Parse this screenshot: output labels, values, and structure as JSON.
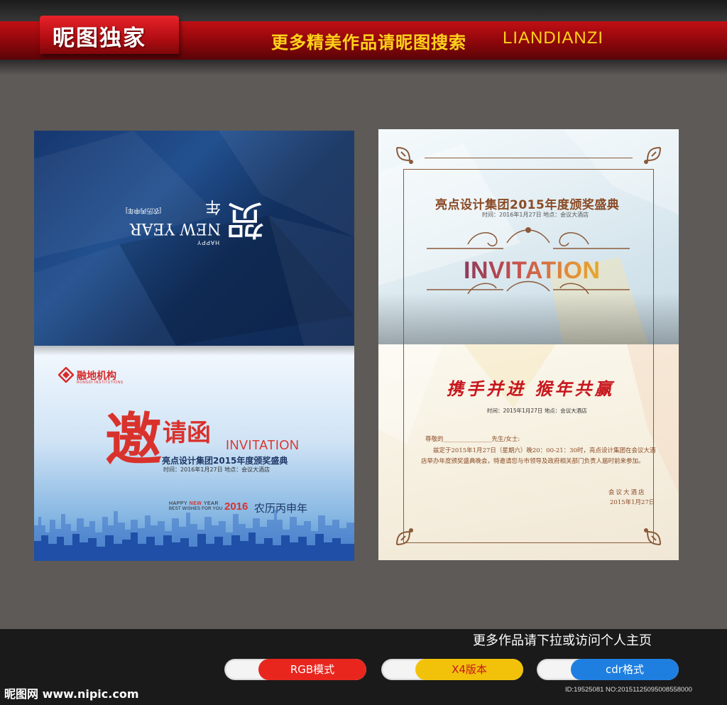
{
  "header": {
    "brand": "昵图独家",
    "slogan": "更多精美作品请昵图搜索",
    "slogan_en": "LIANDIANZI"
  },
  "left_card": {
    "cover": {
      "big": "贺",
      "happy": "HAPPY",
      "ny": "NEW YEAR 年",
      "sub": "[农历丙申年]"
    },
    "logo_cn": "融地机构",
    "logo_en": "RONGDI INSTITUTIONS",
    "inv_big": "邀",
    "inv_2": "请函",
    "inv_en": "INVITATION",
    "title": "亮点设计集团2015年度颁奖盛典",
    "time": "时间：2016年1月27日    地点：会议大酒店",
    "happy_ny_pre": "HAPPY ",
    "happy_ny_b": "NEW ",
    "happy_ny_post": "YEAR",
    "best_wishes": "BEST WISHES FOR YOU",
    "year": "2016",
    "lunar": "农历丙申年"
  },
  "right_card": {
    "title": "亮点设计集团2015年度颁奖盛典",
    "time": "时间：2016年1月27日    地点：会议大酒店",
    "invitation": "INVITATION",
    "slogan": "携手并进  猴年共赢",
    "time2": "时间：2015年1月27日    地点：会议大酒店",
    "dear": "尊敬的________________先生/女士:",
    "body": "兹定于2015年1月27日（星期六）晚20：00-21：30时，亮点设计集团在会议大酒店举办年度颁奖盛典晚会，特邀请您与市领导及政府相关部门负责人届时前来参加。",
    "sign1": "会议大酒店",
    "sign2": "2015年1月27日"
  },
  "footer": {
    "more": "更多作品请下拉或访问个人主页",
    "pills": [
      {
        "label": "RGB模式",
        "color": "#e8261e",
        "text_color": "#ffffff"
      },
      {
        "label": "X4版本",
        "color": "#f2c20a",
        "text_color": "#c8161d"
      },
      {
        "label": "cdr格式",
        "color": "#1e7fe0",
        "text_color": "#ffffff"
      }
    ],
    "site": "昵图网 www.nipic.com",
    "id": "ID:19525081 NO:20151125095008558000"
  }
}
